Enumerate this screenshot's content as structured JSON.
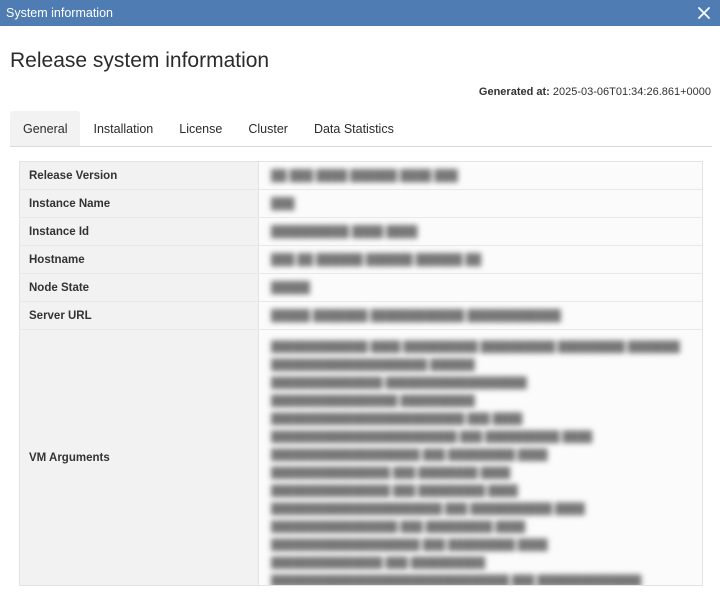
{
  "window": {
    "title": "System information",
    "close_glyph": "✕"
  },
  "page": {
    "heading": "Release system information"
  },
  "generated": {
    "label": "Generated at:",
    "value": "2025-03-06T01:34:26.861+0000"
  },
  "tabs": [
    {
      "label": "General",
      "active": true
    },
    {
      "label": "Installation",
      "active": false
    },
    {
      "label": "License",
      "active": false
    },
    {
      "label": "Cluster",
      "active": false
    },
    {
      "label": "Data Statistics",
      "active": false
    }
  ],
  "rows": [
    {
      "key": "Release Version",
      "value": ""
    },
    {
      "key": "Instance Name",
      "value": ""
    },
    {
      "key": "Instance Id",
      "value": ""
    },
    {
      "key": "Hostname",
      "value": ""
    },
    {
      "key": "Node State",
      "value": ""
    },
    {
      "key": "Server URL",
      "value": ""
    },
    {
      "key": "VM Arguments",
      "value": ""
    }
  ],
  "colors": {
    "titlebar": "#4f7cb3",
    "tab_active_bg": "#f2f2f2",
    "key_bg": "#f2f2f2"
  },
  "icons": {
    "close": "close-icon"
  }
}
